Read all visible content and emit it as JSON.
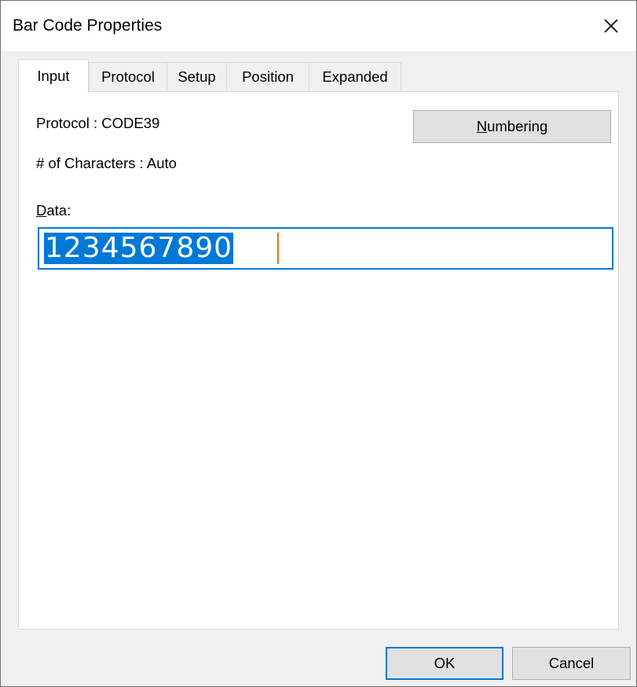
{
  "window": {
    "title": "Bar Code Properties",
    "close_glyph": "✕"
  },
  "tabs": [
    {
      "label": "Input",
      "active": true
    },
    {
      "label": "Protocol",
      "active": false
    },
    {
      "label": "Setup",
      "active": false
    },
    {
      "label": "Position",
      "active": false
    },
    {
      "label": "Expanded",
      "active": false
    }
  ],
  "input_tab": {
    "protocol_text": "Protocol : CODE39",
    "char_count_text": "# of Characters : Auto",
    "numbering_button": {
      "mnemonic": "N",
      "rest": "umbering"
    },
    "data_label": {
      "mnemonic": "D",
      "rest": "ata:"
    },
    "data_value": "1234567890"
  },
  "footer": {
    "ok_label": "OK",
    "cancel_label": "Cancel"
  },
  "colors": {
    "accent": "#0078d7",
    "dialog_bg": "#f0f0f0",
    "panel_bg": "#ffffff"
  }
}
